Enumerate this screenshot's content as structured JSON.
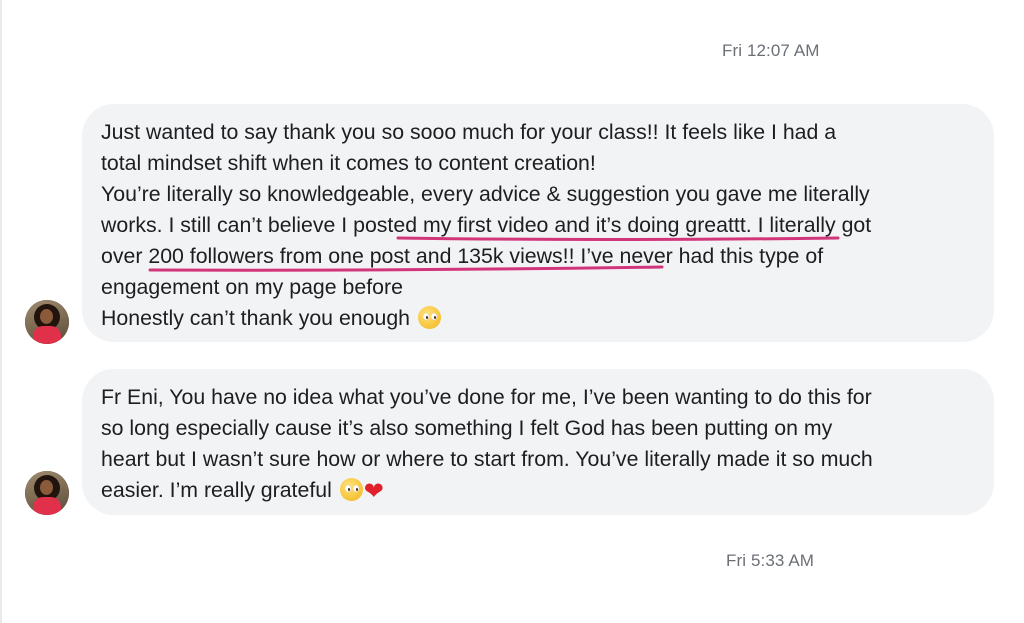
{
  "messages": [
    {
      "timestamp": "Fri 12:07 AM",
      "lines": [
        "Just wanted to say thank you so sooo much for your class!! It feels like I had a",
        "total mindset shift when it comes to content creation!",
        "You’re literally so knowledgeable, every advice & suggestion you gave me literally",
        "works. I still can’t believe I posted my first video and it’s doing greattt. I literally got",
        "over 200 followers from one post and 135k views!! I’ve never had this type of",
        "engagement on my page before",
        "Honestly can’t thank you enough"
      ],
      "emojis": [
        "pleading-face"
      ]
    },
    {
      "lines": [
        "Fr Eni, You have no idea what you’ve done for me, I’ve been wanting to do this for",
        "so long especially cause it’s also something I felt God has been putting on my",
        "heart but I wasn’t sure how or where to start from. You’ve literally made it so much",
        "easier. I’m really grateful"
      ],
      "emojis": [
        "pleading-face",
        "red-heart"
      ]
    }
  ],
  "footer_timestamp": "Fri 5:33 AM",
  "colors": {
    "bubble": "#f2f3f5",
    "text": "#1c1e21",
    "timestamp": "#6b6f76",
    "underline": "#d2367a"
  }
}
